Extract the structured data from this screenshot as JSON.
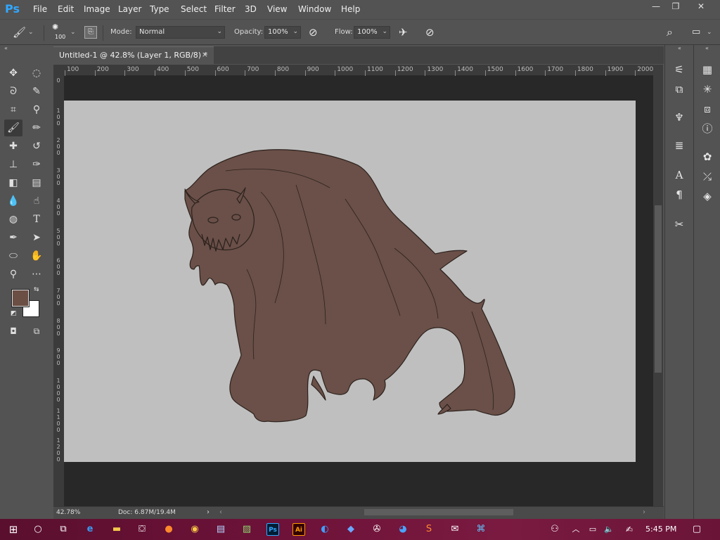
{
  "app": {
    "logo": "Ps"
  },
  "menu": [
    "File",
    "Edit",
    "Image",
    "Layer",
    "Type",
    "Select",
    "Filter",
    "3D",
    "View",
    "Window",
    "Help"
  ],
  "window_controls": {
    "minimize": "—",
    "restore": "❐",
    "close": "✕"
  },
  "options": {
    "brush_size": "100",
    "mode_label": "Mode:",
    "mode_value": "Normal",
    "opacity_label": "Opacity:",
    "opacity_value": "100%",
    "flow_label": "Flow:",
    "flow_value": "100%"
  },
  "document": {
    "tab_title": "Untitled-1 @ 42.8% (Layer 1, RGB/8) *",
    "close": "×"
  },
  "ruler_top": [
    "100",
    "200",
    "300",
    "400",
    "500",
    "600",
    "700",
    "800",
    "900",
    "1000",
    "1100",
    "1200",
    "1300",
    "1400",
    "1500",
    "1600",
    "1700",
    "1800",
    "1900",
    "2000"
  ],
  "ruler_left": [
    {
      "label": "0",
      "chars": [
        "0"
      ]
    },
    {
      "label": "100",
      "chars": [
        "1",
        "0",
        "0"
      ]
    },
    {
      "label": "200",
      "chars": [
        "2",
        "0",
        "0"
      ]
    },
    {
      "label": "300",
      "chars": [
        "3",
        "0",
        "0"
      ]
    },
    {
      "label": "400",
      "chars": [
        "4",
        "0",
        "0"
      ]
    },
    {
      "label": "500",
      "chars": [
        "5",
        "0",
        "0"
      ]
    },
    {
      "label": "600",
      "chars": [
        "6",
        "0",
        "0"
      ]
    },
    {
      "label": "700",
      "chars": [
        "7",
        "0",
        "0"
      ]
    },
    {
      "label": "800",
      "chars": [
        "8",
        "0",
        "0"
      ]
    },
    {
      "label": "900",
      "chars": [
        "9",
        "0",
        "0"
      ]
    },
    {
      "label": "1000",
      "chars": [
        "1",
        "0",
        "0",
        "0"
      ]
    },
    {
      "label": "1100",
      "chars": [
        "1",
        "1",
        "0",
        "0"
      ]
    },
    {
      "label": "1200",
      "chars": [
        "1",
        "2",
        "0",
        "0"
      ]
    }
  ],
  "status": {
    "zoom": "42.78%",
    "doc": "Doc: 6.87M/19.4M"
  },
  "colors": {
    "foreground": "#6b4e44",
    "background": "#ffffff",
    "creature_fill": "#6a5048",
    "canvas": "#bfbfbf"
  },
  "taskbar": {
    "time": "5:45 PM"
  }
}
